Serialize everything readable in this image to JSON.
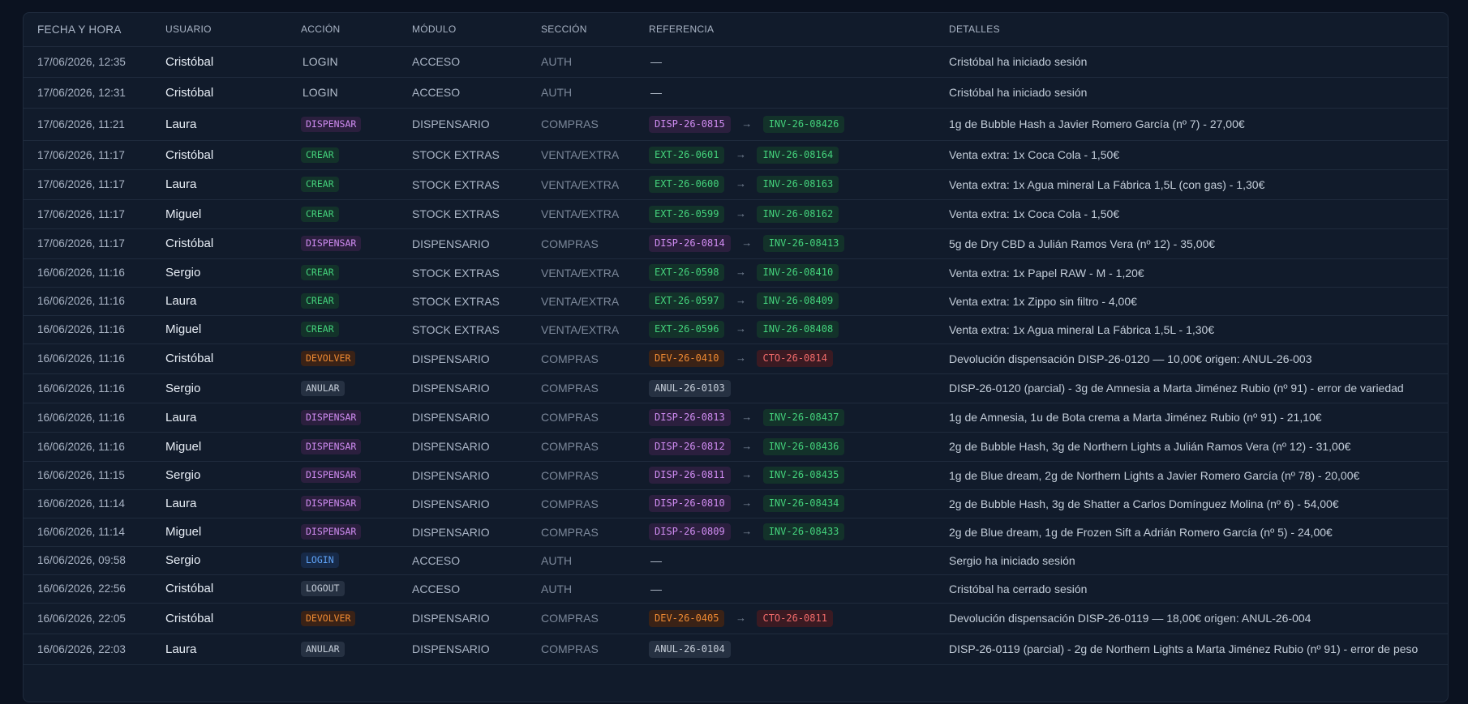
{
  "headers": [
    "FECHA Y HORA",
    "USUARIO",
    "ACCIÓN",
    "MÓDULO",
    "SECCIÓN",
    "REFERENCIA",
    "DETALLES"
  ],
  "colors": {
    "DISPENSAR": "purple",
    "CREAR": "green",
    "DEVOLVER": "orange",
    "ANULAR": "gray",
    "LOGIN_AUTH": "blue",
    "LOGOUT": "gray",
    "DISP": "purple",
    "INV": "green",
    "EXT": "green",
    "DEV": "orange",
    "CTO": "red",
    "ANUL": "gray"
  },
  "rows": [
    {
      "fecha": "17/06/2026, 12:35",
      "usuario": "Cristóbal",
      "accion": "LOGIN",
      "accion_style": "plain",
      "modulo": "ACCESO",
      "seccion": "AUTH",
      "ref1": "—",
      "ref1_style": "plain",
      "ref2": "",
      "ref2_style": "",
      "detalles": "Cristóbal ha iniciado sesión"
    },
    {
      "fecha": "17/06/2026, 12:31",
      "usuario": "Cristóbal",
      "accion": "LOGIN",
      "accion_style": "plain",
      "modulo": "ACCESO",
      "seccion": "AUTH",
      "ref1": "—",
      "ref1_style": "plain",
      "ref2": "",
      "ref2_style": "",
      "detalles": "Cristóbal ha iniciado sesión"
    },
    {
      "fecha": "17/06/2026, 11:21",
      "usuario": "Laura",
      "accion": "DISPENSAR",
      "accion_style": "purple",
      "modulo": "DISPENSARIO",
      "seccion": "COMPRAS",
      "ref1": "DISP-26-0815",
      "ref1_style": "purple",
      "ref2": "INV-26-08426",
      "ref2_style": "green",
      "detalles": "1g de Bubble Hash a Javier Romero García (nº 7) - 27,00€"
    },
    {
      "fecha": "17/06/2026, 11:17",
      "usuario": "Cristóbal",
      "accion": "CREAR",
      "accion_style": "green",
      "modulo": "STOCK EXTRAS",
      "seccion": "VENTA/EXTRA",
      "ref1": "EXT-26-0601",
      "ref1_style": "green",
      "ref2": "INV-26-08164",
      "ref2_style": "green",
      "detalles": "Venta extra: 1x Coca Cola - 1,50€"
    },
    {
      "fecha": "17/06/2026, 11:17",
      "usuario": "Laura",
      "accion": "CREAR",
      "accion_style": "green",
      "modulo": "STOCK EXTRAS",
      "seccion": "VENTA/EXTRA",
      "ref1": "EXT-26-0600",
      "ref1_style": "green",
      "ref2": "INV-26-08163",
      "ref2_style": "green",
      "detalles": "Venta extra: 1x Agua mineral La Fábrica 1,5L (con gas) - 1,30€"
    },
    {
      "fecha": "17/06/2026, 11:17",
      "usuario": "Miguel",
      "accion": "CREAR",
      "accion_style": "green",
      "modulo": "STOCK EXTRAS",
      "seccion": "VENTA/EXTRA",
      "ref1": "EXT-26-0599",
      "ref1_style": "green",
      "ref2": "INV-26-08162",
      "ref2_style": "green",
      "detalles": "Venta extra: 1x Coca Cola - 1,50€"
    },
    {
      "fecha": "17/06/2026, 11:17",
      "usuario": "Cristóbal",
      "accion": "DISPENSAR",
      "accion_style": "purple",
      "modulo": "DISPENSARIO",
      "seccion": "COMPRAS",
      "ref1": "DISP-26-0814",
      "ref1_style": "purple",
      "ref2": "INV-26-08413",
      "ref2_style": "green",
      "detalles": "5g de Dry CBD a Julián Ramos Vera (nº 12) - 35,00€"
    },
    {
      "fecha": "16/06/2026, 11:16",
      "usuario": "Sergio",
      "accion": "CREAR",
      "accion_style": "green",
      "modulo": "STOCK EXTRAS",
      "seccion": "VENTA/EXTRA",
      "ref1": "EXT-26-0598",
      "ref1_style": "green",
      "ref2": "INV-26-08410",
      "ref2_style": "green",
      "detalles": "Venta extra: 1x Papel RAW - M - 1,20€"
    },
    {
      "fecha": "16/06/2026, 11:16",
      "usuario": "Laura",
      "accion": "CREAR",
      "accion_style": "green",
      "modulo": "STOCK EXTRAS",
      "seccion": "VENTA/EXTRA",
      "ref1": "EXT-26-0597",
      "ref1_style": "green",
      "ref2": "INV-26-08409",
      "ref2_style": "green",
      "detalles": "Venta extra: 1x Zippo sin filtro - 4,00€"
    },
    {
      "fecha": "16/06/2026, 11:16",
      "usuario": "Miguel",
      "accion": "CREAR",
      "accion_style": "green",
      "modulo": "STOCK EXTRAS",
      "seccion": "VENTA/EXTRA",
      "ref1": "EXT-26-0596",
      "ref1_style": "green",
      "ref2": "INV-26-08408",
      "ref2_style": "green",
      "detalles": "Venta extra: 1x Agua mineral La Fábrica 1,5L - 1,30€"
    },
    {
      "fecha": "16/06/2026, 11:16",
      "usuario": "Cristóbal",
      "accion": "DEVOLVER",
      "accion_style": "orange",
      "modulo": "DISPENSARIO",
      "seccion": "COMPRAS",
      "ref1": "DEV-26-0410",
      "ref1_style": "orange",
      "ref2": "CTO-26-0814",
      "ref2_style": "red",
      "detalles": "Devolución dispensación DISP-26-0120 — 10,00€ origen: ANUL-26-003"
    },
    {
      "fecha": "16/06/2026, 11:16",
      "usuario": "Sergio",
      "accion": "ANULAR",
      "accion_style": "gray",
      "modulo": "DISPENSARIO",
      "seccion": "COMPRAS",
      "ref1": "ANUL-26-0103",
      "ref1_style": "gray",
      "ref2": "",
      "ref2_style": "",
      "detalles": "DISP-26-0120 (parcial) - 3g de Amnesia a Marta Jiménez Rubio (nº 91) - error de variedad"
    },
    {
      "fecha": "16/06/2026, 11:16",
      "usuario": "Laura",
      "accion": "DISPENSAR",
      "accion_style": "purple",
      "modulo": "DISPENSARIO",
      "seccion": "COMPRAS",
      "ref1": "DISP-26-0813",
      "ref1_style": "purple",
      "ref2": "INV-26-08437",
      "ref2_style": "green",
      "detalles": "1g de Amnesia, 1u de Bota crema a Marta Jiménez Rubio (nº 91) - 21,10€"
    },
    {
      "fecha": "16/06/2026, 11:16",
      "usuario": "Miguel",
      "accion": "DISPENSAR",
      "accion_style": "purple",
      "modulo": "DISPENSARIO",
      "seccion": "COMPRAS",
      "ref1": "DISP-26-0812",
      "ref1_style": "purple",
      "ref2": "INV-26-08436",
      "ref2_style": "green",
      "detalles": "2g de Bubble Hash, 3g de Northern Lights a Julián Ramos Vera (nº 12) - 31,00€"
    },
    {
      "fecha": "16/06/2026, 11:15",
      "usuario": "Sergio",
      "accion": "DISPENSAR",
      "accion_style": "purple",
      "modulo": "DISPENSARIO",
      "seccion": "COMPRAS",
      "ref1": "DISP-26-0811",
      "ref1_style": "purple",
      "ref2": "INV-26-08435",
      "ref2_style": "green",
      "detalles": "1g de Blue dream, 2g de Northern Lights a Javier Romero García (nº 78) - 20,00€"
    },
    {
      "fecha": "16/06/2026, 11:14",
      "usuario": "Laura",
      "accion": "DISPENSAR",
      "accion_style": "purple",
      "modulo": "DISPENSARIO",
      "seccion": "COMPRAS",
      "ref1": "DISP-26-0810",
      "ref1_style": "purple",
      "ref2": "INV-26-08434",
      "ref2_style": "green",
      "detalles": "2g de Bubble Hash, 3g de Shatter a Carlos Domínguez Molina (nº 6) - 54,00€"
    },
    {
      "fecha": "16/06/2026, 11:14",
      "usuario": "Miguel",
      "accion": "DISPENSAR",
      "accion_style": "purple",
      "modulo": "DISPENSARIO",
      "seccion": "COMPRAS",
      "ref1": "DISP-26-0809",
      "ref1_style": "purple",
      "ref2": "INV-26-08433",
      "ref2_style": "green",
      "detalles": "2g de Blue dream, 1g de Frozen Sift a Adrián Romero García (nº 5) - 24,00€"
    },
    {
      "fecha": "16/06/2026, 09:58",
      "usuario": "Sergio",
      "accion": "LOGIN",
      "accion_style": "blue",
      "modulo": "ACCESO",
      "seccion": "AUTH",
      "ref1": "—",
      "ref1_style": "plain",
      "ref2": "",
      "ref2_style": "",
      "detalles": "Sergio ha iniciado sesión"
    },
    {
      "fecha": "16/06/2026, 22:56",
      "usuario": "Cristóbal",
      "accion": "LOGOUT",
      "accion_style": "gray",
      "modulo": "ACCESO",
      "seccion": "AUTH",
      "ref1": "—",
      "ref1_style": "plain",
      "ref2": "",
      "ref2_style": "",
      "detalles": "Cristóbal ha cerrado sesión"
    },
    {
      "fecha": "16/06/2026, 22:05",
      "usuario": "Cristóbal",
      "accion": "DEVOLVER",
      "accion_style": "orange",
      "modulo": "DISPENSARIO",
      "seccion": "COMPRAS",
      "ref1": "DEV-26-0405",
      "ref1_style": "orange",
      "ref2": "CTO-26-0811",
      "ref2_style": "red",
      "detalles": "Devolución dispensación DISP-26-0119 — 18,00€ origen: ANUL-26-004"
    },
    {
      "fecha": "16/06/2026, 22:03",
      "usuario": "Laura",
      "accion": "ANULAR",
      "accion_style": "gray",
      "modulo": "DISPENSARIO",
      "seccion": "COMPRAS",
      "ref1": "ANUL-26-0104",
      "ref1_style": "gray",
      "ref2": "",
      "ref2_style": "",
      "detalles": "DISP-26-0119 (parcial) - 2g de Northern Lights a Marta Jiménez Rubio (nº 91) - error de peso"
    }
  ],
  "arrow": "→"
}
